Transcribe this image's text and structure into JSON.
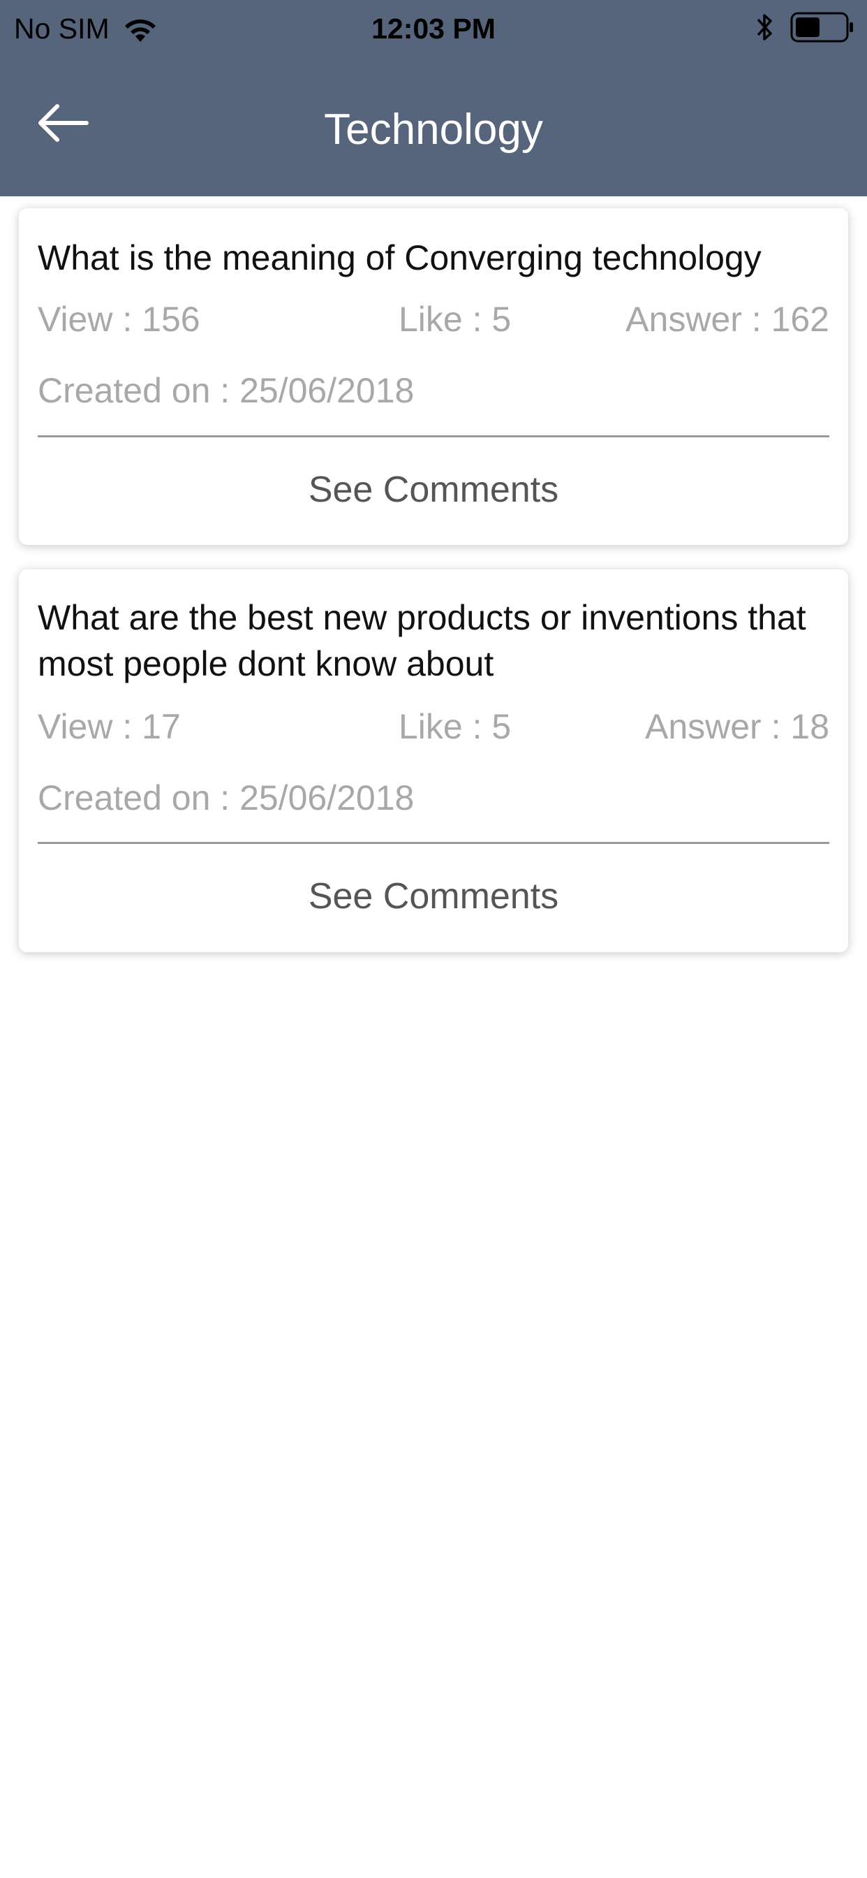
{
  "status_bar": {
    "carrier": "No SIM",
    "time": "12:03 PM",
    "icons": [
      "wifi-icon",
      "bluetooth-icon",
      "battery-icon"
    ]
  },
  "nav": {
    "title": "Technology",
    "back_icon": "back-arrow-icon"
  },
  "colors": {
    "header_bg": "#56657c",
    "meta_text": "#a8a8a8",
    "question_text": "#111111",
    "link_text": "#555555"
  },
  "questions": [
    {
      "title": "What is the meaning of Converging technology",
      "views": "View : 156",
      "likes": "Like : 5",
      "answers": "Answer : 162",
      "created": "Created on : 25/06/2018",
      "action": "See Comments"
    },
    {
      "title": "What are the best new products or inventions that most people dont know about",
      "views": "View : 17",
      "likes": "Like : 5",
      "answers": "Answer : 18",
      "created": "Created on : 25/06/2018",
      "action": "See Comments"
    }
  ]
}
